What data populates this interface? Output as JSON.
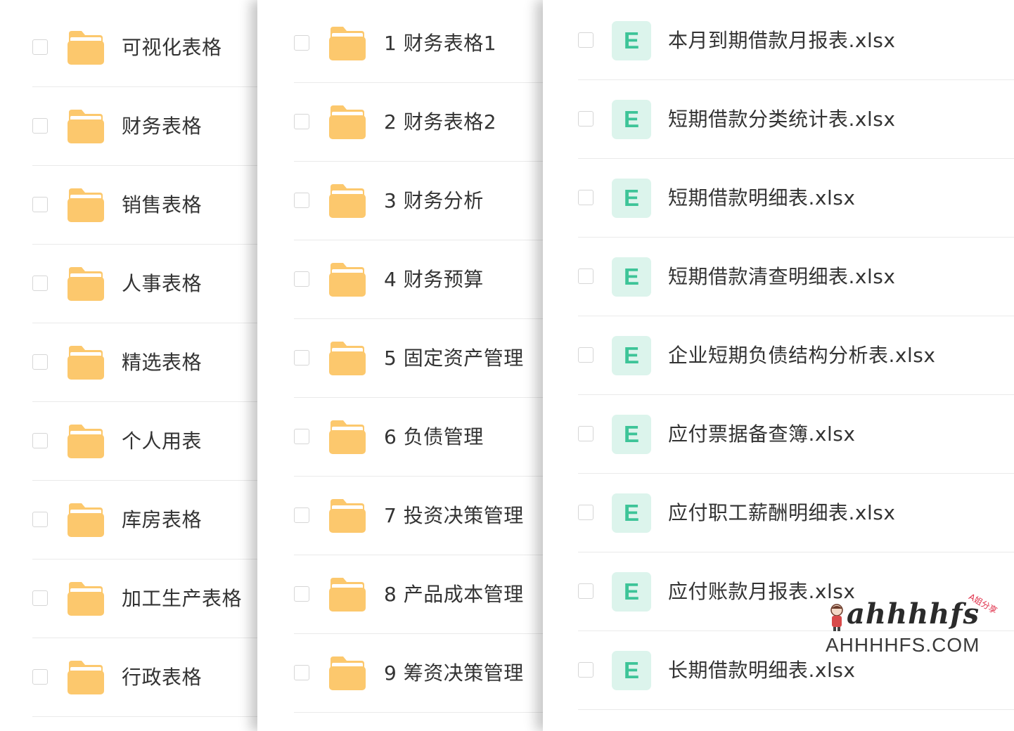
{
  "colors": {
    "folder": "#fcc86d",
    "file_icon_bg": "#dcf4ec",
    "file_icon_text": "#3dc498",
    "text": "#333333",
    "divider": "#eaeaea",
    "checkbox_border": "#d6d6d6"
  },
  "folders_level1": [
    {
      "name": "可视化表格"
    },
    {
      "name": "财务表格"
    },
    {
      "name": "销售表格"
    },
    {
      "name": "人事表格"
    },
    {
      "name": "精选表格"
    },
    {
      "name": "个人用表"
    },
    {
      "name": "库房表格"
    },
    {
      "name": "加工生产表格"
    },
    {
      "name": "行政表格"
    }
  ],
  "folders_level2": [
    {
      "name": "1 财务表格1"
    },
    {
      "name": "2 财务表格2"
    },
    {
      "name": "3 财务分析"
    },
    {
      "name": "4 财务预算"
    },
    {
      "name": "5 固定资产管理"
    },
    {
      "name": "6 负债管理"
    },
    {
      "name": "7 投资决策管理"
    },
    {
      "name": "8 产品成本管理"
    },
    {
      "name": "9 筹资决策管理"
    }
  ],
  "files": [
    {
      "icon_letter": "E",
      "name": "本月到期借款月报表.xlsx"
    },
    {
      "icon_letter": "E",
      "name": "短期借款分类统计表.xlsx"
    },
    {
      "icon_letter": "E",
      "name": "短期借款明细表.xlsx"
    },
    {
      "icon_letter": "E",
      "name": "短期借款清查明细表.xlsx"
    },
    {
      "icon_letter": "E",
      "name": "企业短期负债结构分析表.xlsx"
    },
    {
      "icon_letter": "E",
      "name": "应付票据备查簿.xlsx"
    },
    {
      "icon_letter": "E",
      "name": "应付职工薪酬明细表.xlsx"
    },
    {
      "icon_letter": "E",
      "name": "应付账款月报表.xlsx"
    },
    {
      "icon_letter": "E",
      "name": "长期借款明细表.xlsx"
    }
  ],
  "watermark": {
    "script_text": "ahhhhfs",
    "tag_text": "A姐分享",
    "domain_text": "AHHHHFS.COM"
  }
}
